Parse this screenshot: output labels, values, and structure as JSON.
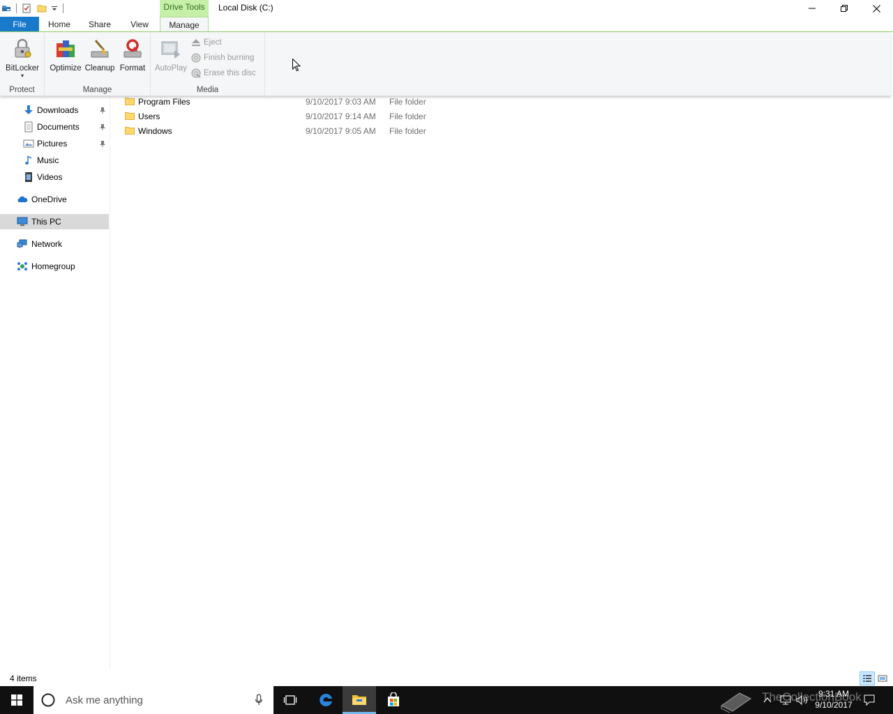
{
  "window": {
    "title": "Local Disk (C:)",
    "context_tab_header": "Drive Tools"
  },
  "tabs": {
    "file": "File",
    "home": "Home",
    "share": "Share",
    "view": "View",
    "manage": "Manage"
  },
  "ribbon": {
    "protect": {
      "label": "Protect",
      "bitlocker": "BitLocker"
    },
    "manage": {
      "label": "Manage",
      "optimize": "Optimize",
      "cleanup": "Cleanup",
      "format": "Format"
    },
    "media": {
      "label": "Media",
      "autoplay": "AutoPlay",
      "eject": "Eject",
      "finish_burning": "Finish burning",
      "erase_disc": "Erase this disc"
    }
  },
  "nav": {
    "downloads": "Downloads",
    "documents": "Documents",
    "pictures": "Pictures",
    "music": "Music",
    "videos": "Videos",
    "onedrive": "OneDrive",
    "this_pc": "This PC",
    "network": "Network",
    "homegroup": "Homegroup"
  },
  "files": [
    {
      "name": "Program Files",
      "date": "9/10/2017 9:03 AM",
      "type": "File folder"
    },
    {
      "name": "Users",
      "date": "9/10/2017 9:14 AM",
      "type": "File folder"
    },
    {
      "name": "Windows",
      "date": "9/10/2017 9:05 AM",
      "type": "File folder"
    }
  ],
  "status": {
    "item_count": "4 items"
  },
  "taskbar": {
    "search_placeholder": "Ask me anything",
    "time": "9:31 AM",
    "date": "9/10/2017",
    "watermark": "TheCollectionBook"
  },
  "colors": {
    "file_tab": "#1979ca",
    "context_tab": "#c6f0a7",
    "ribbon_bg": "#f5f6f7",
    "taskbar": "#101010"
  }
}
